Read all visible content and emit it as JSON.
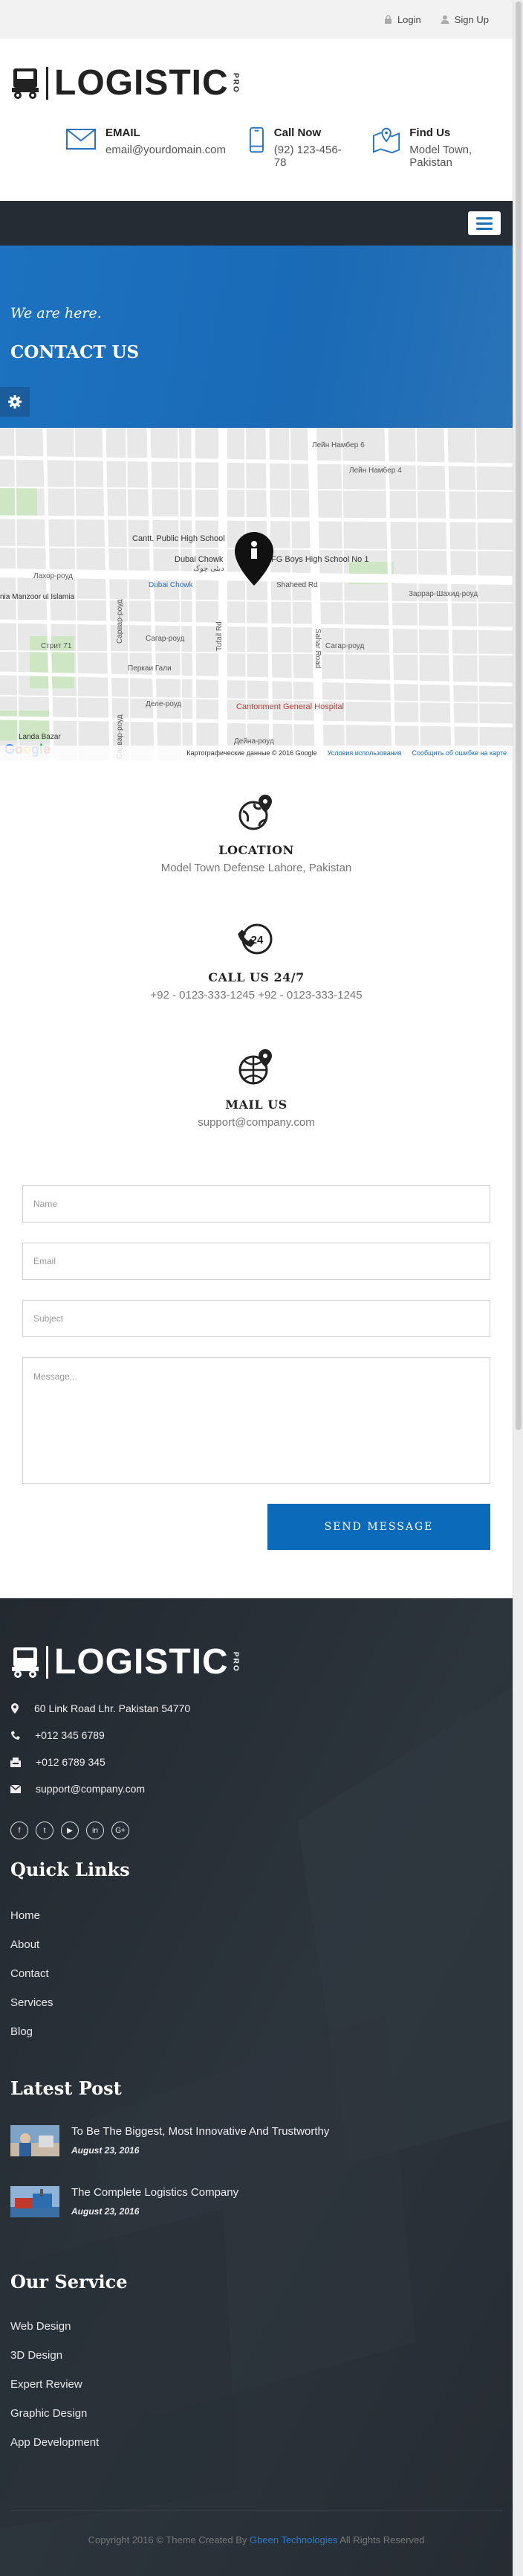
{
  "topbar": {
    "login": "Login",
    "signup": "Sign Up"
  },
  "logo": {
    "text": "LOGISTIC",
    "pro": "PRO"
  },
  "header": {
    "email": {
      "title": "EMAIL",
      "value": "email@yourdomain.com"
    },
    "call": {
      "title": "Call Now",
      "value": "(92) 123-456-78"
    },
    "find": {
      "title": "Find Us",
      "value": "Model Town, Pakistan"
    }
  },
  "hero": {
    "subtitle": "We are here.",
    "title": "CONTACT US"
  },
  "map": {
    "labels": {
      "l1": "Лейн Намбер 6",
      "l2": "Лейн Намбер 4",
      "l3": "Cantt. Public High School",
      "l4": "Dubai Chowk",
      "l5": "دبئی چوک",
      "l6": "FG Boys High School No 1",
      "l7": "Лахор-роуд",
      "l8": "Dubai Chowk",
      "l9": "Shaheed Rd",
      "l10": "Заррар-Шахид-роуд",
      "l11": "nia Manzoor ul Islamia",
      "l12": "Стрит 71",
      "l13": "Сагар-роуд",
      "l14": "Сагар-роуд",
      "l15": "Перкаи Гали",
      "l16": "Деле-роуд",
      "l17": "Cantonment General Hospital",
      "l18": "Landa Bazar",
      "l19": "Дейна-роуд",
      "l20": "Сарвар-роуд",
      "l21": "Tufail Rd",
      "l22": "Sahar Road",
      "l23": "Сарвар-роуд"
    },
    "footer_data": "Картографические данные © 2016 Google",
    "footer_terms": "Условия использования",
    "footer_report": "Сообщить об ошибке на карте",
    "google": "Google"
  },
  "location": {
    "title": "LOCATION",
    "value": "Model Town Defense Lahore, Pakistan"
  },
  "call247": {
    "title": "CALL US 24/7",
    "value": "+92 - 0123-333-1245 +92 - 0123-333-1245",
    "badge": "24"
  },
  "mail": {
    "title": "MAIL US",
    "value": "support@company.com"
  },
  "form": {
    "name_placeholder": "Name",
    "email_placeholder": "Email",
    "subject_placeholder": "Subject",
    "message_placeholder": "Message...",
    "send_label": "SEND MESSAGE"
  },
  "footer": {
    "address": "60 Link Road Lhr. Pakistan 54770",
    "phone": "+012 345 6789",
    "fax": "+012 6789 345",
    "email": "support@company.com",
    "socials": [
      "f",
      "t",
      "▶",
      "in",
      "G+"
    ],
    "quick_links_title": "Quick Links",
    "quick_links": [
      "Home",
      "About",
      "Contact",
      "Services",
      "Blog"
    ],
    "latest_post_title": "Latest Post",
    "posts": [
      {
        "title": "To Be The Biggest, Most Innovative And Trustworthy",
        "date": "August 23, 2016"
      },
      {
        "title": "The Complete Logistics Company",
        "date": "August 23, 2016"
      }
    ],
    "service_title": "Our Service",
    "services": [
      "Web Design",
      "3D Design",
      "Expert Review",
      "Graphic Design",
      "App Development"
    ],
    "copyright_pre": "Copyright 2016 © Theme Created By",
    "copyright_brand": "Gbeen Technologies",
    "copyright_post": "All Rights Reserved"
  },
  "colors": {
    "accent": "#0b6ab9",
    "nav": "#252c34",
    "footer": "#272d33"
  }
}
